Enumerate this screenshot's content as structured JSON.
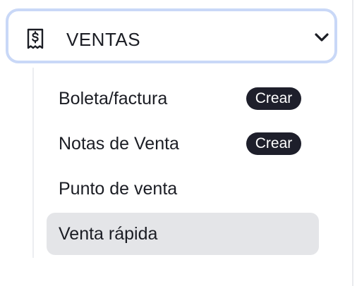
{
  "section": {
    "title": "VENTAS",
    "icon": "receipt-dollar-icon",
    "toggle_icon": "chevron-down-icon",
    "border_color": "#c9d8f7"
  },
  "menu": {
    "items": [
      {
        "label": "Boleta/factura",
        "badge": "Crear",
        "active": false
      },
      {
        "label": "Notas de Venta",
        "badge": "Crear",
        "active": false
      },
      {
        "label": "Punto de venta",
        "active": false
      },
      {
        "label": "Venta rápida",
        "active": true
      }
    ]
  },
  "colors": {
    "badge_bg": "#1e1f2b",
    "active_bg": "#e4e5e8",
    "text": "#1b1d24"
  }
}
